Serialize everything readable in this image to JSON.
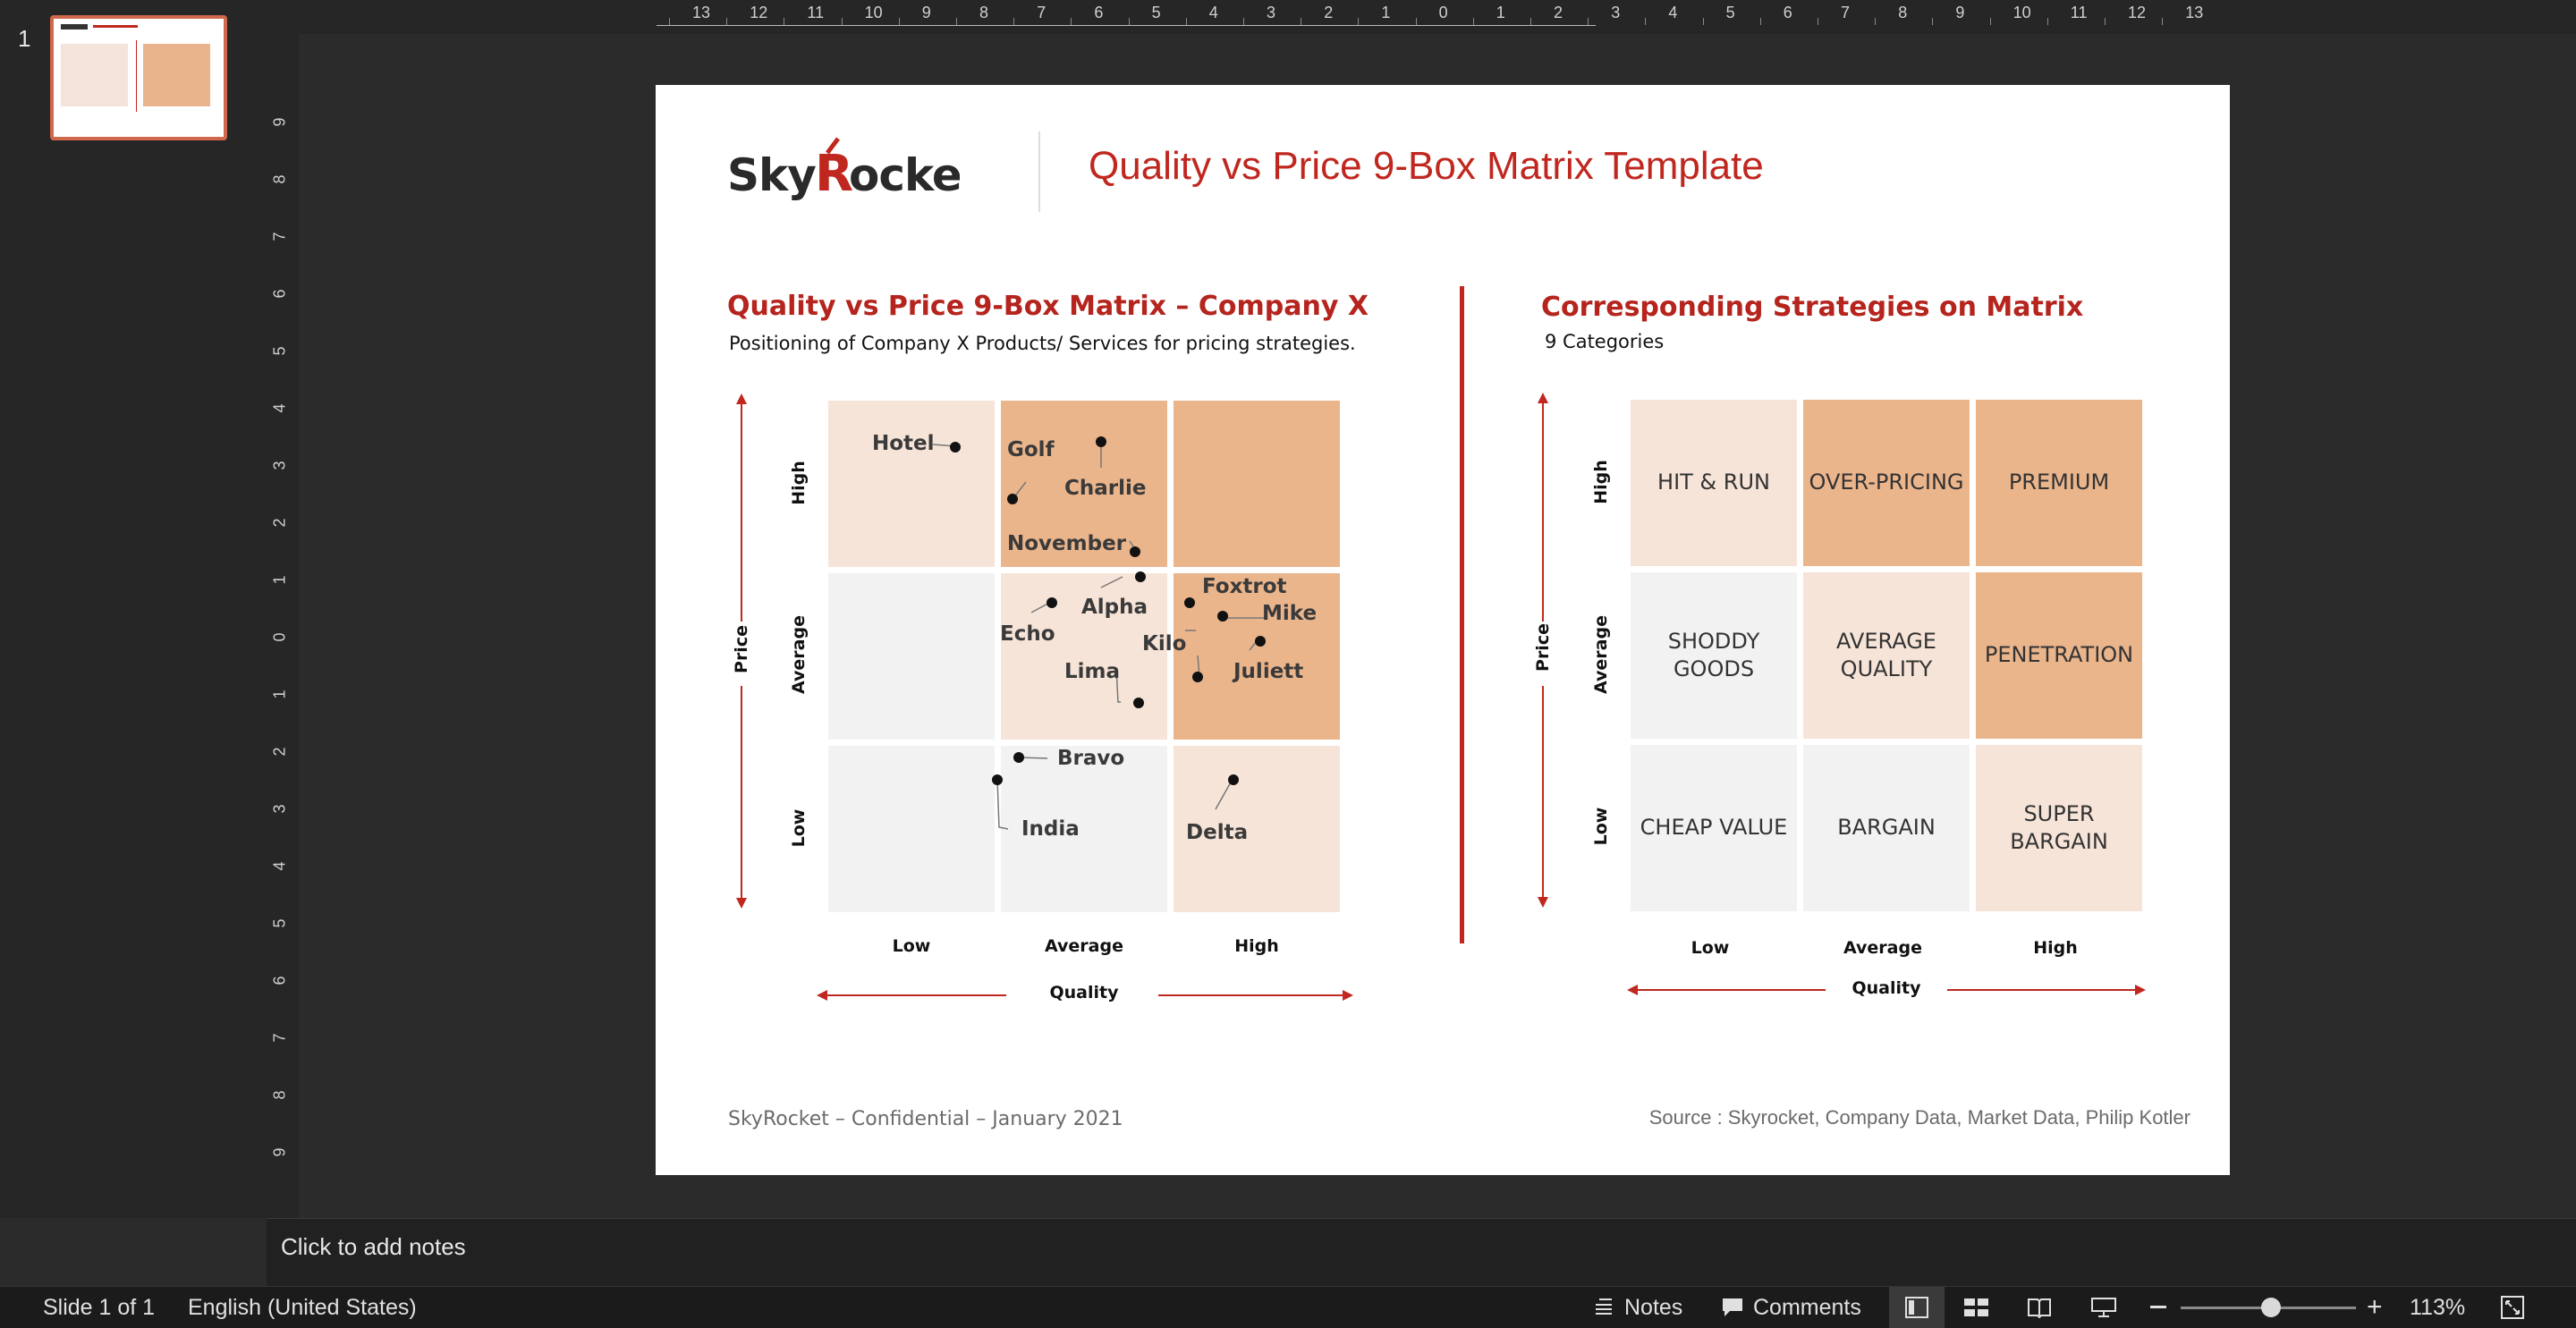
{
  "app": {
    "slide_index": "1",
    "notes_placeholder": "Click to add notes",
    "status": {
      "slide_info": "Slide 1 of 1",
      "language": "English (United States)",
      "notes_label": "Notes",
      "comments_label": "Comments",
      "zoom": "113%"
    },
    "ruler_top": [
      "13",
      "12",
      "11",
      "10",
      "9",
      "8",
      "7",
      "6",
      "5",
      "4",
      "3",
      "2",
      "1",
      "0",
      "1",
      "2",
      "3",
      "4",
      "5",
      "6",
      "7",
      "8",
      "9",
      "10",
      "11",
      "12",
      "13"
    ],
    "ruler_left": [
      "9",
      "8",
      "7",
      "6",
      "5",
      "4",
      "3",
      "2",
      "1",
      "0",
      "1",
      "2",
      "3",
      "4",
      "5",
      "6",
      "7",
      "8",
      "9"
    ]
  },
  "slide": {
    "logo": "SkyRocket",
    "title": "Quality vs Price 9-Box Matrix Template",
    "left": {
      "heading": "Quality vs Price 9-Box Matrix – Company X",
      "subheading": "Positioning of Company X Products/ Services for pricing strategies.",
      "price_label": "Price",
      "quality_label": "Quality",
      "row_labels": [
        "High",
        "Average",
        "Low"
      ],
      "col_labels": [
        "Low",
        "Average",
        "High"
      ],
      "points": [
        {
          "label": "Hotel",
          "quality": "Low",
          "price": "High"
        },
        {
          "label": "Golf",
          "quality": "Average",
          "price": "High"
        },
        {
          "label": "Charlie",
          "quality": "Average",
          "price": "High"
        },
        {
          "label": "November",
          "quality": "Average",
          "price": "High"
        },
        {
          "label": "Alpha",
          "quality": "Average",
          "price": "Average"
        },
        {
          "label": "Echo",
          "quality": "Average",
          "price": "Average"
        },
        {
          "label": "Lima",
          "quality": "Average",
          "price": "Average"
        },
        {
          "label": "Kilo",
          "quality": "High",
          "price": "Average"
        },
        {
          "label": "Foxtrot",
          "quality": "High",
          "price": "Average"
        },
        {
          "label": "Mike",
          "quality": "High",
          "price": "Average"
        },
        {
          "label": "Juliett",
          "quality": "High",
          "price": "Average"
        },
        {
          "label": "Bravo",
          "quality": "Average",
          "price": "Low"
        },
        {
          "label": "India",
          "quality": "Low",
          "price": "Low"
        },
        {
          "label": "Delta",
          "quality": "High",
          "price": "Low"
        }
      ]
    },
    "right": {
      "heading": "Corresponding Strategies on Matrix",
      "subheading": "9 Categories",
      "price_label": "Price",
      "quality_label": "Quality",
      "row_labels": [
        "High",
        "Average",
        "Low"
      ],
      "col_labels": [
        "Low",
        "Average",
        "High"
      ],
      "cells": [
        [
          "HIT & RUN",
          "OVER-PRICING",
          "PREMIUM"
        ],
        [
          "SHODDY GOODS",
          "AVERAGE QUALITY",
          "PENETRATION"
        ],
        [
          "CHEAP VALUE",
          "BARGAIN",
          "SUPER BARGAIN"
        ]
      ]
    },
    "footer_left": "SkyRocket – Confidential – January 2021",
    "footer_right": "Source : Skyrocket, Company Data, Market Data, Philip Kotler"
  }
}
